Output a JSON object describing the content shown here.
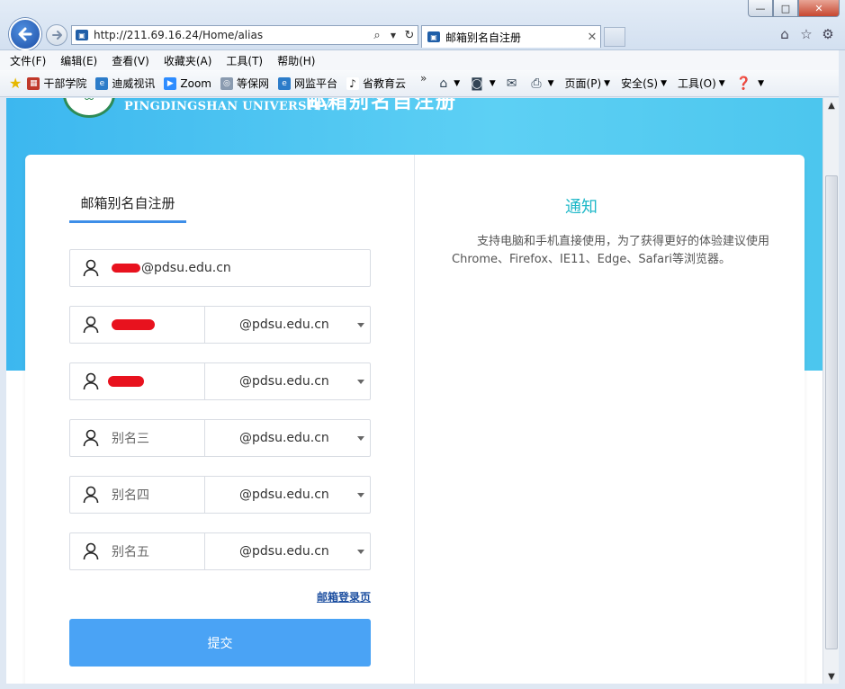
{
  "window": {
    "minimize": "—",
    "maximize": "□",
    "close": "✕"
  },
  "address": {
    "url": "http://211.69.16.24/Home/alias"
  },
  "tab": {
    "title": "邮箱别名自注册"
  },
  "menu": [
    "文件(F)",
    "编辑(E)",
    "查看(V)",
    "收藏夹(A)",
    "工具(T)",
    "帮助(H)"
  ],
  "favorites": [
    {
      "label": "干部学院",
      "color": "#c0392b"
    },
    {
      "label": "迪威视讯",
      "color": "#2c7cc9"
    },
    {
      "label": "Zoom",
      "color": "#2d8cff"
    },
    {
      "label": "等保网",
      "color": "#8a9bb0"
    },
    {
      "label": "网监平台",
      "color": "#2c7cc9"
    },
    {
      "label": "省教育云",
      "color": "#222222"
    }
  ],
  "favorites_more": "»",
  "commands": {
    "page": "页面(P)",
    "safety": "安全(S)",
    "tools": "工具(O)"
  },
  "header": {
    "university": "PINGDINGSHAN UNIVERSITY",
    "title": "邮箱别名自注册"
  },
  "form": {
    "tab_label": "邮箱别名自注册",
    "primary_email_suffix": "@pdsu.edu.cn",
    "aliases": [
      {
        "value": "",
        "redacted": true,
        "domain": "@pdsu.edu.cn"
      },
      {
        "value": "",
        "redacted": true,
        "domain": "@pdsu.edu.cn"
      },
      {
        "placeholder": "别名三",
        "domain": "@pdsu.edu.cn"
      },
      {
        "placeholder": "别名四",
        "domain": "@pdsu.edu.cn"
      },
      {
        "placeholder": "别名五",
        "domain": "@pdsu.edu.cn"
      }
    ],
    "login_link": "邮箱登录页",
    "submit_label": "提交"
  },
  "notice": {
    "title": "通知",
    "body": "支持电脑和手机直接使用，为了获得更好的体验建议使用Chrome、Firefox、IE11、Edge、Safari等浏览器。"
  },
  "colors": {
    "accent": "#4aa3f5",
    "hero": "#3cb7ef",
    "notice_title": "#1fb8c8",
    "redaction": "#e8121e"
  }
}
